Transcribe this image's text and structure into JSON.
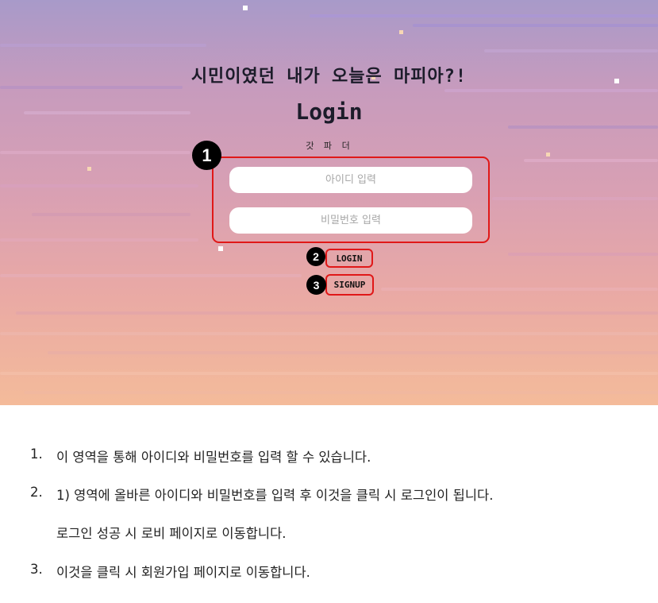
{
  "hero": {
    "subtitle": "시민이였던 내가 오늘은 마피아?!",
    "title": "Login",
    "tagline": "갓 파 더"
  },
  "form": {
    "id_placeholder": "아이디 입력",
    "pw_placeholder": "비밀번호 입력",
    "login_label": "LOGIN",
    "signup_label": "SIGNUP"
  },
  "markers": {
    "m1": "1",
    "m2": "2",
    "m3": "3"
  },
  "notes": [
    {
      "num": "1.",
      "text": "이 영역을 통해 아이디와 비밀번호를 입력 할 수 있습니다."
    },
    {
      "num": "2.",
      "text": "1) 영역에 올바른 아이디와 비밀번호를 입력 후 이것을 클릭 시 로그인이 됩니다."
    },
    {
      "num": "",
      "text": "로그인 성공 시 로비 페이지로 이동합니다."
    },
    {
      "num": "3.",
      "text": "이것을 클릭 시 회원가입 페이지로 이동합니다."
    }
  ],
  "colors": {
    "annotation_red": "#e01818",
    "marker_black": "#000000",
    "gradient_top": "#a89ac9",
    "gradient_bottom": "#f4bb9a"
  }
}
